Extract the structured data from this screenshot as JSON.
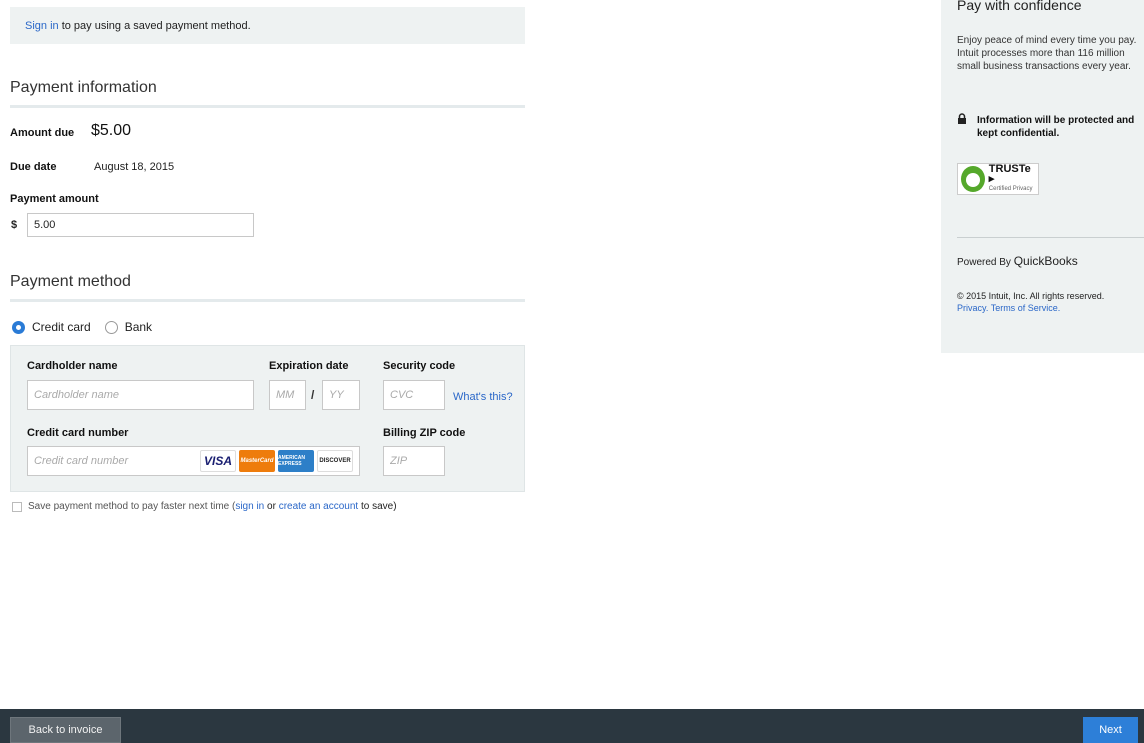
{
  "signin_banner": {
    "link": "Sign in",
    "text": " to pay using a saved payment method."
  },
  "payment_info": {
    "title": "Payment information",
    "amount_due_label": "Amount due",
    "amount_due_value": "$5.00",
    "due_date_label": "Due date",
    "due_date_value": "August 18, 2015",
    "payment_amount_label": "Payment amount",
    "currency_symbol": "$",
    "payment_amount_value": "5.00"
  },
  "payment_method": {
    "title": "Payment method",
    "options": [
      {
        "label": "Credit card",
        "selected": true
      },
      {
        "label": "Bank",
        "selected": false
      }
    ]
  },
  "card_form": {
    "cardholder_label": "Cardholder name",
    "cardholder_placeholder": "Cardholder name",
    "expiration_label": "Expiration date",
    "month_placeholder": "MM",
    "separator": "/",
    "year_placeholder": "YY",
    "security_label": "Security code",
    "cvc_placeholder": "CVC",
    "whats_this": "What's this?",
    "number_label": "Credit card number",
    "number_placeholder": "Credit card number",
    "zip_label": "Billing ZIP code",
    "zip_placeholder": "ZIP",
    "card_logos": [
      {
        "name": "visa-logo",
        "text": "VISA"
      },
      {
        "name": "mastercard-logo",
        "text": "MasterCard"
      },
      {
        "name": "amex-logo",
        "text": "AMERICAN EXPRESS"
      },
      {
        "name": "discover-logo",
        "text": "DISCOVER"
      }
    ]
  },
  "save_row": {
    "text_before": "Save payment method to pay faster next time (",
    "signin_link": "sign in",
    "text_or": " or ",
    "create_link": "create an account",
    "text_after": " to save)"
  },
  "sidebar": {
    "title": "Pay with confidence",
    "body": "Enjoy peace of mind every time you pay. Intuit processes more than 116 million small business transactions every year.",
    "secure_text": "Information will be protected and kept confidential.",
    "truste_name": "TRUSTe ▸",
    "truste_sub": "Certified Privacy",
    "powered_prefix": "Powered By ",
    "powered_brand": "QuickBooks",
    "copyright": "© 2015 Intuit, Inc. All rights reserved.",
    "privacy_link": "Privacy.",
    "terms_link": "Terms of Service."
  },
  "footer": {
    "back_label": "Back to invoice",
    "next_label": "Next"
  },
  "colors": {
    "accent": "#2d7fd8",
    "panel_bg": "#eef2f2",
    "footer_bg": "#2b3740",
    "link": "#2a67c8"
  }
}
